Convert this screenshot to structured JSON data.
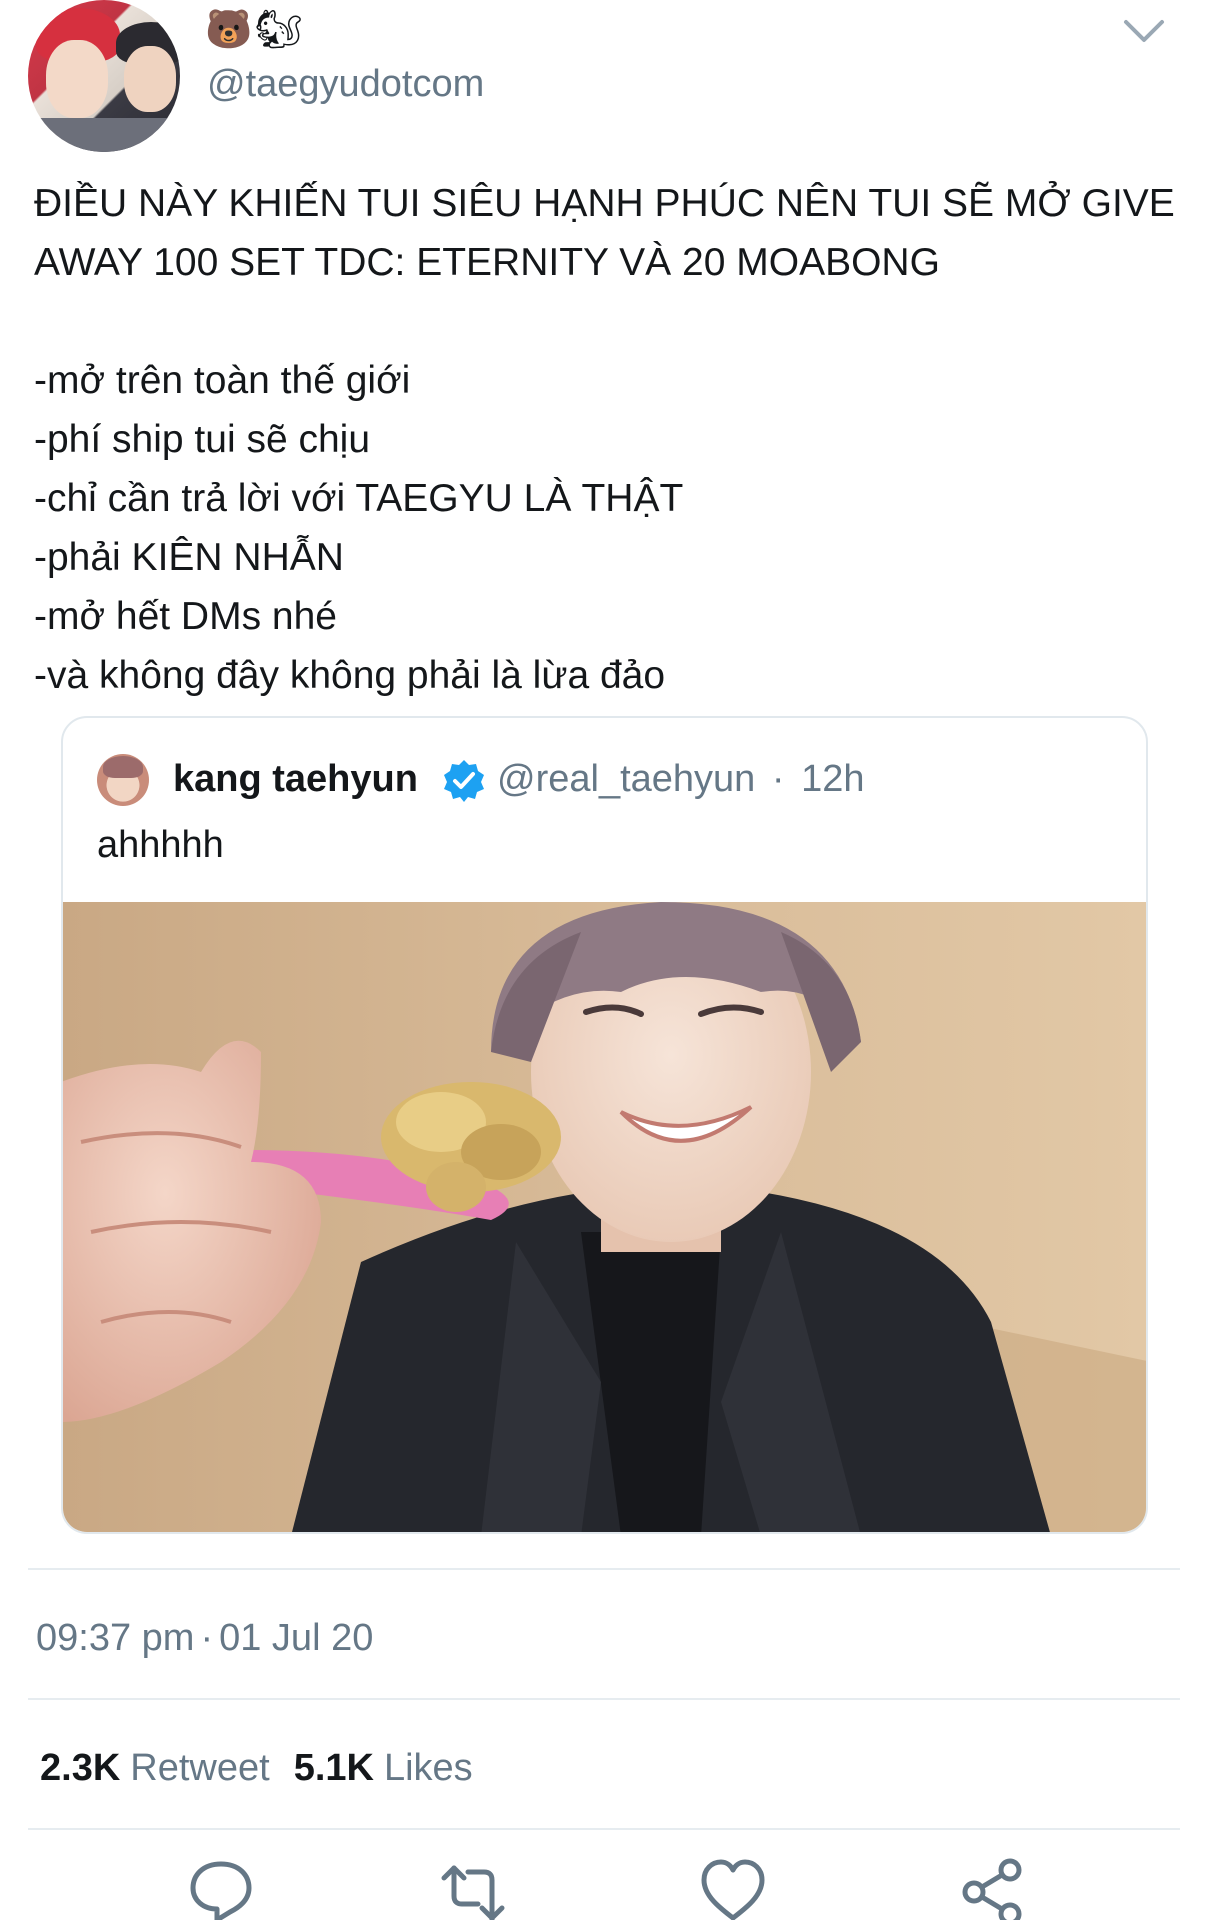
{
  "author": {
    "emojis": "🐻🐿",
    "handle": "@taegyudotcom"
  },
  "tweet": {
    "headline": "ĐIỀU NÀY KHIẾN TUI SIÊU HẠNH PHÚC NÊN TUI SẼ MỞ GIVE AWAY 100 SET TDC: ETERNITY VÀ 20 MOABONG",
    "lines": [
      "-mở trên toàn thế giới",
      "-phí ship tui sẽ chịu",
      "-chỉ cần trả lời với TAEGYU LÀ THẬT",
      "-phải KIÊN NHẪN",
      "-mở hết DMs nhé",
      "-và không đây không phải là lừa đảo"
    ]
  },
  "quoted_tweet": {
    "name": "kang taehyun",
    "handle": "@real_taehyun",
    "separator": "·",
    "time": "12h",
    "text": "ahhhhh"
  },
  "timestamp": {
    "time": "09:37 pm",
    "separator": "·",
    "date": "01 Jul 20"
  },
  "stats": {
    "retweets_count": "2.3K",
    "retweets_label": "Retweet",
    "likes_count": "5.1K",
    "likes_label": "Likes"
  },
  "actions": [
    "reply-icon",
    "retweet-icon",
    "like-icon",
    "share-icon"
  ],
  "colors": {
    "text": "#14171a",
    "muted": "#657786",
    "border": "#e1e8ed",
    "verified": "#1da1f2"
  }
}
